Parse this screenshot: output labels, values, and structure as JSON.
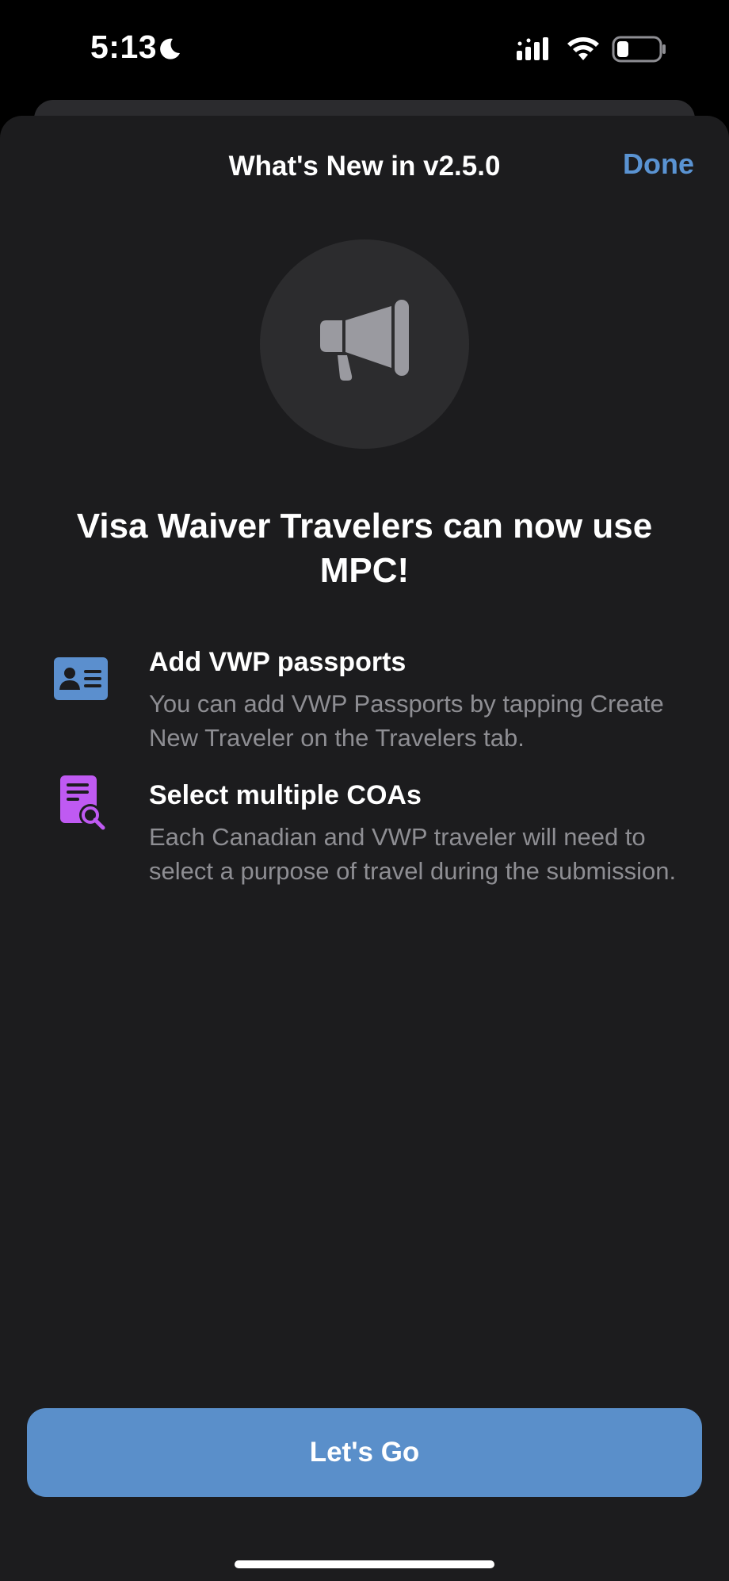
{
  "status_bar": {
    "time": "5:13",
    "icons": [
      "moon-icon",
      "signal-icon",
      "wifi-icon",
      "battery-icon"
    ]
  },
  "sheet": {
    "title": "What's New in v2.5.0",
    "done_label": "Done",
    "hero_icon": "megaphone-icon",
    "headline": "Visa Waiver Travelers can now use MPC!",
    "features": [
      {
        "icon": "id-card-icon",
        "title": "Add VWP passports",
        "description": "You can add VWP Passports by tapping Create New Traveler on the Travelers tab."
      },
      {
        "icon": "document-search-icon",
        "title": "Select multiple COAs",
        "description": "Each Canadian and VWP traveler will need to select a purpose of travel during the submission."
      }
    ],
    "cta_label": "Let's Go"
  },
  "colors": {
    "background": "#1c1c1e",
    "accent": "#5a93d2",
    "button": "#5a8fca",
    "secondary_text": "#8e8e93",
    "id_card_icon": "#5b8fce",
    "document_icon": "#bf5af2"
  }
}
